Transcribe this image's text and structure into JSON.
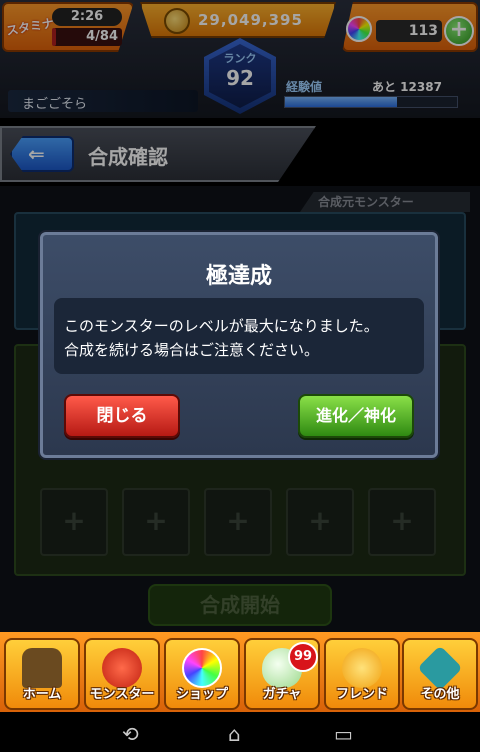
{
  "status": {
    "stamina_label": "スタミナ",
    "stamina_timer": "2:26",
    "stamina_value": "4/84",
    "stamina_ratio": 0.05,
    "gold": "29,049,395",
    "orbs": "113",
    "player_name": "まごごそら",
    "rank_label": "ランク",
    "rank_value": "92",
    "exp_label": "経験値",
    "exp_remaining": "あと 12387",
    "exp_ratio": 0.65
  },
  "header": {
    "title": "合成確認"
  },
  "background": {
    "source_label": "合成元モンスター",
    "start_button": "合成開始",
    "slot_plus": "+"
  },
  "modal": {
    "title": "極達成",
    "message_line1": "このモンスターのレベルが最大になりました。",
    "message_line2": "合成を続ける場合はご注意ください。",
    "close_label": "閉じる",
    "evolve_label": "進化／神化"
  },
  "nav": {
    "items": [
      {
        "label": "ホーム",
        "icon": "home-icon"
      },
      {
        "label": "モンスター",
        "icon": "monster-icon"
      },
      {
        "label": "ショップ",
        "icon": "shop-orb-icon"
      },
      {
        "label": "ガチャ",
        "icon": "gacha-egg-icon"
      },
      {
        "label": "フレンド",
        "icon": "friends-icon"
      },
      {
        "label": "その他",
        "icon": "other-icon"
      }
    ],
    "gacha_badge": "99"
  },
  "system": {
    "back_icon": "back-icon",
    "home_icon": "home-button-icon",
    "recents_icon": "recents-icon"
  },
  "colors": {
    "accent_orange": "#f08a0a",
    "close_red": "#b61a14",
    "evolve_green": "#2f8a12",
    "rank_blue": "#1f3a8a"
  }
}
